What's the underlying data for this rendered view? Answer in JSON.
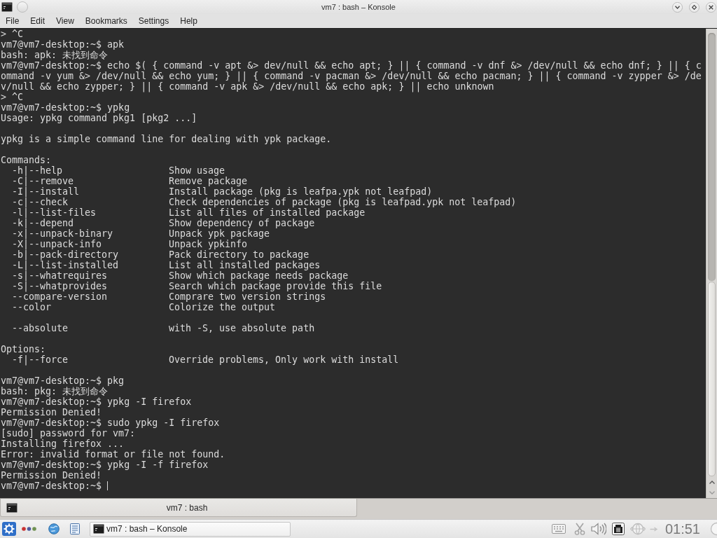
{
  "window": {
    "title": "vm7 : bash – Konsole"
  },
  "menu": [
    "File",
    "Edit",
    "View",
    "Bookmarks",
    "Settings",
    "Help"
  ],
  "terminal": {
    "lines": [
      {
        "kind": "output",
        "text": "> ^C"
      },
      {
        "kind": "prompt",
        "prompt": "vm7@vm7-desktop:~$",
        "command": "apk"
      },
      {
        "kind": "output",
        "text": "bash: apk: 未找到命令"
      },
      {
        "kind": "prompt",
        "prompt": "vm7@vm7-desktop:~$",
        "command": "echo $( { command -v apt &> dev/null && echo apt; } || { command -v dnf &> /dev/null && echo dnf; } || { c"
      },
      {
        "kind": "output",
        "text": "ommand -v yum &> /dev/null && echo yum; } || { command -v pacman &> /dev/null && echo pacman; } || { command -v zypper &> /de"
      },
      {
        "kind": "output",
        "text": "v/null && echo zypper; } || { command -v apk &> /dev/null && echo apk; } || echo unknown"
      },
      {
        "kind": "output",
        "text": "> ^C"
      },
      {
        "kind": "prompt",
        "prompt": "vm7@vm7-desktop:~$",
        "command": "ypkg"
      },
      {
        "kind": "output",
        "text": "Usage: ypkg command pkg1 [pkg2 ...]"
      },
      {
        "kind": "blank"
      },
      {
        "kind": "output",
        "text": "ypkg is a simple command line for dealing with ypk package."
      },
      {
        "kind": "blank"
      },
      {
        "kind": "output",
        "text": "Commands:"
      },
      {
        "kind": "option",
        "flag": "-h|--help",
        "description": "Show usage"
      },
      {
        "kind": "option",
        "flag": "-C|--remove",
        "description": "Remove package"
      },
      {
        "kind": "option",
        "flag": "-I|--install",
        "description": "Install package (pkg is leafpa.ypk not leafpad)"
      },
      {
        "kind": "option",
        "flag": "-c|--check",
        "description": "Check dependencies of package (pkg is leafpad.ypk not leafpad)"
      },
      {
        "kind": "option",
        "flag": "-l|--list-files",
        "description": "List all files of installed package"
      },
      {
        "kind": "option",
        "flag": "-k|--depend",
        "description": "Show dependency of package"
      },
      {
        "kind": "option",
        "flag": "-x|--unpack-binary",
        "description": "Unpack ypk package"
      },
      {
        "kind": "option",
        "flag": "-X|--unpack-info",
        "description": "Unpack ypkinfo"
      },
      {
        "kind": "option",
        "flag": "-b|--pack-directory",
        "description": "Pack directory to package"
      },
      {
        "kind": "option",
        "flag": "-L|--list-installed",
        "description": "List all installed packages"
      },
      {
        "kind": "option",
        "flag": "-s|--whatrequires",
        "description": "Show which package needs package"
      },
      {
        "kind": "option",
        "flag": "-S|--whatprovides",
        "description": "Search which package provide this file"
      },
      {
        "kind": "option",
        "flag": "--compare-version",
        "description": "Comprare two version strings"
      },
      {
        "kind": "option",
        "flag": "--color",
        "description": "Colorize the output"
      },
      {
        "kind": "blank"
      },
      {
        "kind": "option",
        "flag": "--absolute",
        "description": "with -S, use absolute path"
      },
      {
        "kind": "blank"
      },
      {
        "kind": "output",
        "text": "Options:"
      },
      {
        "kind": "option",
        "flag": "-f|--force",
        "description": "Override problems, Only work with install"
      },
      {
        "kind": "blank"
      },
      {
        "kind": "prompt",
        "prompt": "vm7@vm7-desktop:~$",
        "command": "pkg"
      },
      {
        "kind": "output",
        "text": "bash: pkg: 未找到命令"
      },
      {
        "kind": "prompt",
        "prompt": "vm7@vm7-desktop:~$",
        "command": "ypkg -I firefox"
      },
      {
        "kind": "output",
        "text": "Permission Denied!"
      },
      {
        "kind": "prompt",
        "prompt": "vm7@vm7-desktop:~$",
        "command": "sudo ypkg -I firefox"
      },
      {
        "kind": "output",
        "text": "[sudo] password for vm7:"
      },
      {
        "kind": "output",
        "text": "Installing firefox ..."
      },
      {
        "kind": "output",
        "text": "Error: invalid format or file not found."
      },
      {
        "kind": "prompt",
        "prompt": "vm7@vm7-desktop:~$",
        "command": "ypkg -I -f firefox"
      },
      {
        "kind": "output",
        "text": "Permission Denied!"
      },
      {
        "kind": "prompt",
        "prompt": "vm7@vm7-desktop:~$",
        "cursor": true
      }
    ]
  },
  "tabs": [
    {
      "label": "vm7 : bash",
      "selected": true
    }
  ],
  "taskbar": {
    "tasks": [
      {
        "label": "vm7 : bash – Konsole",
        "selected": true
      }
    ],
    "clock": "01:51"
  }
}
